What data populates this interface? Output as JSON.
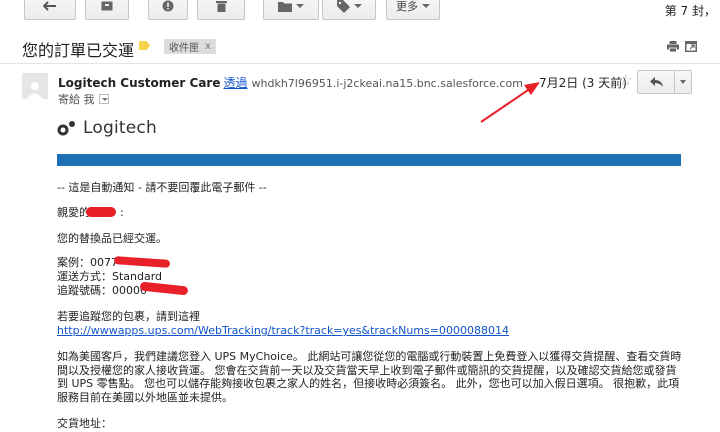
{
  "toolbar": {
    "more_label": "更多",
    "page_info": "第 7 封，"
  },
  "subject": {
    "title": "您的訂單已交運",
    "label": "收件匣",
    "label_close": "x"
  },
  "sender": {
    "name": "Logitech Customer Care",
    "via": "透過",
    "address": "whdkh7l96951.i-j2ckeai.na15.bnc.salesforce.com",
    "to": "寄給 我",
    "date": "7月2日 (3 天前)"
  },
  "email": {
    "logo_text": "Logitech",
    "auto_notice": "-- 這是自動通知 - 請不要回覆此電子郵件 --",
    "greeting": "親愛的",
    "greeting_suffix": ":",
    "status": "您的替換品已經交運。",
    "case_label": "案例：",
    "case_value": "0077",
    "ship_label": "運送方式：",
    "ship_value": "Standard",
    "tracking_label": "追蹤號碼：",
    "tracking_value": "00000",
    "track_intro": "若要追蹤您的包裹，請到這裡",
    "track_link": "http://wwwapps.ups.com/WebTracking/track?track=yes&trackNums=0000088014",
    "ups_paragraph": "如為美國客戶，我們建議您登入 UPS MyChoice。 此網站可讓您從您的電腦或行動裝置上免費登入以獲得交貨提醒、查看交貨時間以及授權您的家人接收貨運。 您會在交貨前一天以及交貨當天早上收到電子郵件或簡訊的交貨提醒，以及確認交貨給您或發貨到 UPS 零售點。 您也可以儲存能夠接收包裹之家人的姓名，但接收時必須簽名。 此外，您也可以加入假日選項。 很抱歉，此項服務目前在美國以外地區並未提供。",
    "address_label": "交貨地址："
  },
  "colors": {
    "accent_bar": "#1f6fb5",
    "link": "#1155cc",
    "redaction": "#e8202a",
    "annotation_arrow": "#e8202a",
    "label_tag": "#f6d44b"
  }
}
